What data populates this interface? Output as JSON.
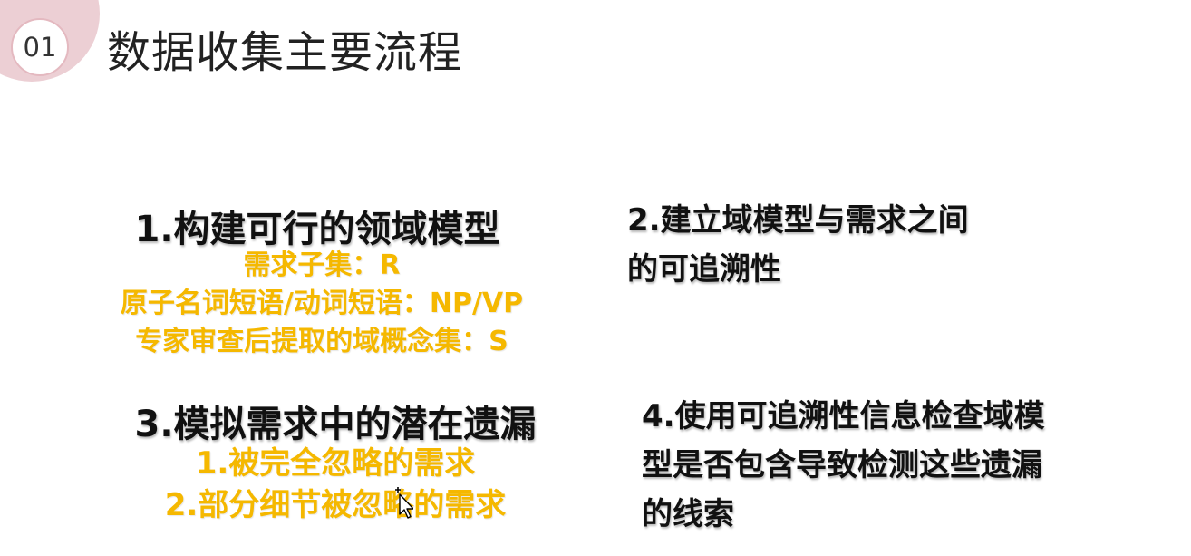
{
  "badge": {
    "number": "01"
  },
  "title": "数据收集主要流程",
  "sections": [
    {
      "heading": "1.构建可行的领域模型",
      "items": [
        "需求子集：R",
        "原子名词短语/动词短语：NP/VP",
        "专家审查后提取的域概念集：S"
      ]
    },
    {
      "heading_lines": [
        "2.建立域模型与需求之间",
        "的可追溯性"
      ]
    },
    {
      "heading": "3.模拟需求中的潜在遗漏",
      "items": [
        "1.被完全忽略的需求",
        "2.部分细节被忽略的需求"
      ]
    },
    {
      "heading_lines": [
        "4.使用可追溯性信息检查域模",
        "型是否包含导致检测这些遗漏",
        "的线索"
      ]
    }
  ],
  "colors": {
    "accent": "#f5b800",
    "badge": "#eccfd4",
    "text": "#111111"
  },
  "icons": {
    "cursor": "mouse-pointer-icon"
  }
}
